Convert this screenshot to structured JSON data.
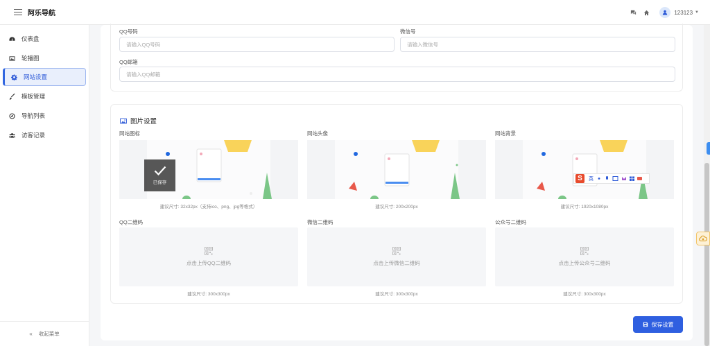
{
  "app": {
    "title": "阿乐导航"
  },
  "user": {
    "name": "123123"
  },
  "sidebar": {
    "items": [
      {
        "label": "仪表盘",
        "icon": "dashboard-icon"
      },
      {
        "label": "轮播图",
        "icon": "image-icon"
      },
      {
        "label": "网站设置",
        "icon": "gear-icon",
        "active": true
      },
      {
        "label": "模板管理",
        "icon": "brush-icon"
      },
      {
        "label": "导航列表",
        "icon": "compass-icon"
      },
      {
        "label": "访客记录",
        "icon": "users-icon"
      }
    ],
    "collapse_label": "收起菜单"
  },
  "contact": {
    "qq_label": "QQ号码",
    "qq_placeholder": "请输入QQ号码",
    "wechat_label": "微信号",
    "wechat_placeholder": "请输入微信号",
    "email_label": "QQ邮箱",
    "email_placeholder": "请输入QQ邮箱"
  },
  "images": {
    "section_title": "图片设置",
    "favicon": {
      "label": "网站图标",
      "hint": "建议尺寸: 32x32px（支持ico、png、jpg等格式）",
      "saved_label": "已保存"
    },
    "avatar": {
      "label": "网站头像",
      "hint": "建议尺寸: 200x200px"
    },
    "background": {
      "label": "网站背景",
      "hint": "建议尺寸: 1920x1080px"
    },
    "qq_qr": {
      "label": "QQ二维码",
      "upload_text": "点击上传QQ二维码",
      "hint": "建议尺寸: 300x300px"
    },
    "wechat_qr": {
      "label": "微信二维码",
      "upload_text": "点击上传微信二维码",
      "hint": "建议尺寸: 300x300px"
    },
    "official_qr": {
      "label": "公众号二维码",
      "upload_text": "点击上传公众号二维码",
      "hint": "建议尺寸: 300x300px"
    }
  },
  "ime_bar": {
    "logo": "S",
    "lang": "英"
  },
  "actions": {
    "save_label": "保存设置"
  },
  "colors": {
    "primary": "#2f5fe0",
    "sidebar_active_bg": "#e9effc",
    "page_bg": "#f5f6f8"
  }
}
